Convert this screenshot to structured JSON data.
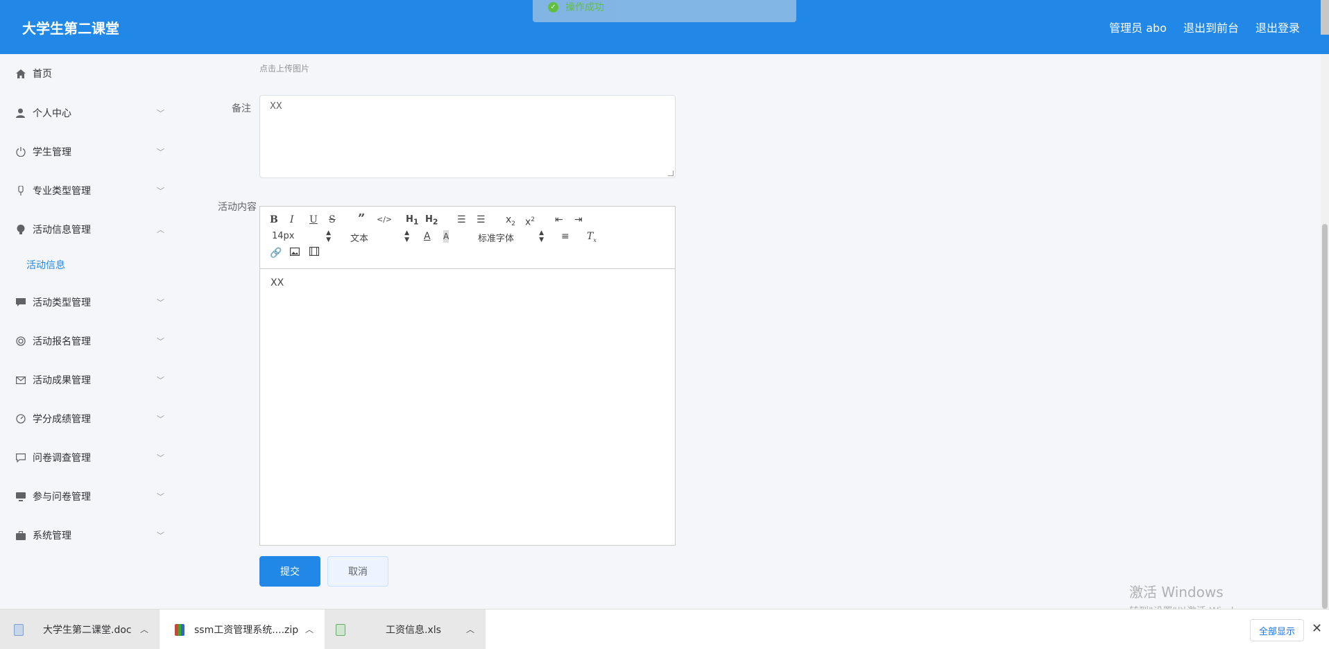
{
  "header": {
    "title": "大学生第二课堂",
    "links": [
      "管理员 abo",
      "退出到前台",
      "退出登录"
    ]
  },
  "toast": {
    "message": "操作成功"
  },
  "sidebar": {
    "items": [
      {
        "label": "首页",
        "icon": "home-icon"
      },
      {
        "label": "个人中心",
        "icon": "user-icon"
      },
      {
        "label": "学生管理",
        "icon": "power-icon"
      },
      {
        "label": "专业类型管理",
        "icon": "mic-icon"
      },
      {
        "label": "活动信息管理",
        "icon": "bulb-icon"
      },
      {
        "label": "活动类型管理",
        "icon": "chat-icon"
      },
      {
        "label": "活动报名管理",
        "icon": "lifebuoy-icon"
      },
      {
        "label": "活动成果管理",
        "icon": "mail-icon"
      },
      {
        "label": "学分成绩管理",
        "icon": "gauge-icon"
      },
      {
        "label": "问卷调查管理",
        "icon": "comment-icon"
      },
      {
        "label": "参与问卷管理",
        "icon": "monitor-icon"
      },
      {
        "label": "系统管理",
        "icon": "briefcase-icon"
      }
    ],
    "active_sub": "活动信息"
  },
  "form": {
    "upload_hint": "点击上传图片",
    "remark_label": "备注",
    "remark_value": "XX",
    "content_label": "活动内容",
    "content_value": "XX",
    "submit_label": "提交",
    "cancel_label": "取消"
  },
  "editor": {
    "font_size": "14px",
    "header_select": "文本",
    "font_family": "标准字体"
  },
  "watermark": {
    "line1": "激活 Windows",
    "line2": "转到\"设置\"以激活 Windows。"
  },
  "downloads": {
    "items": [
      "大学生第二课堂.doc",
      "ssm工资管理系统....zip",
      "工资信息.xls"
    ],
    "show_all": "全部显示"
  }
}
